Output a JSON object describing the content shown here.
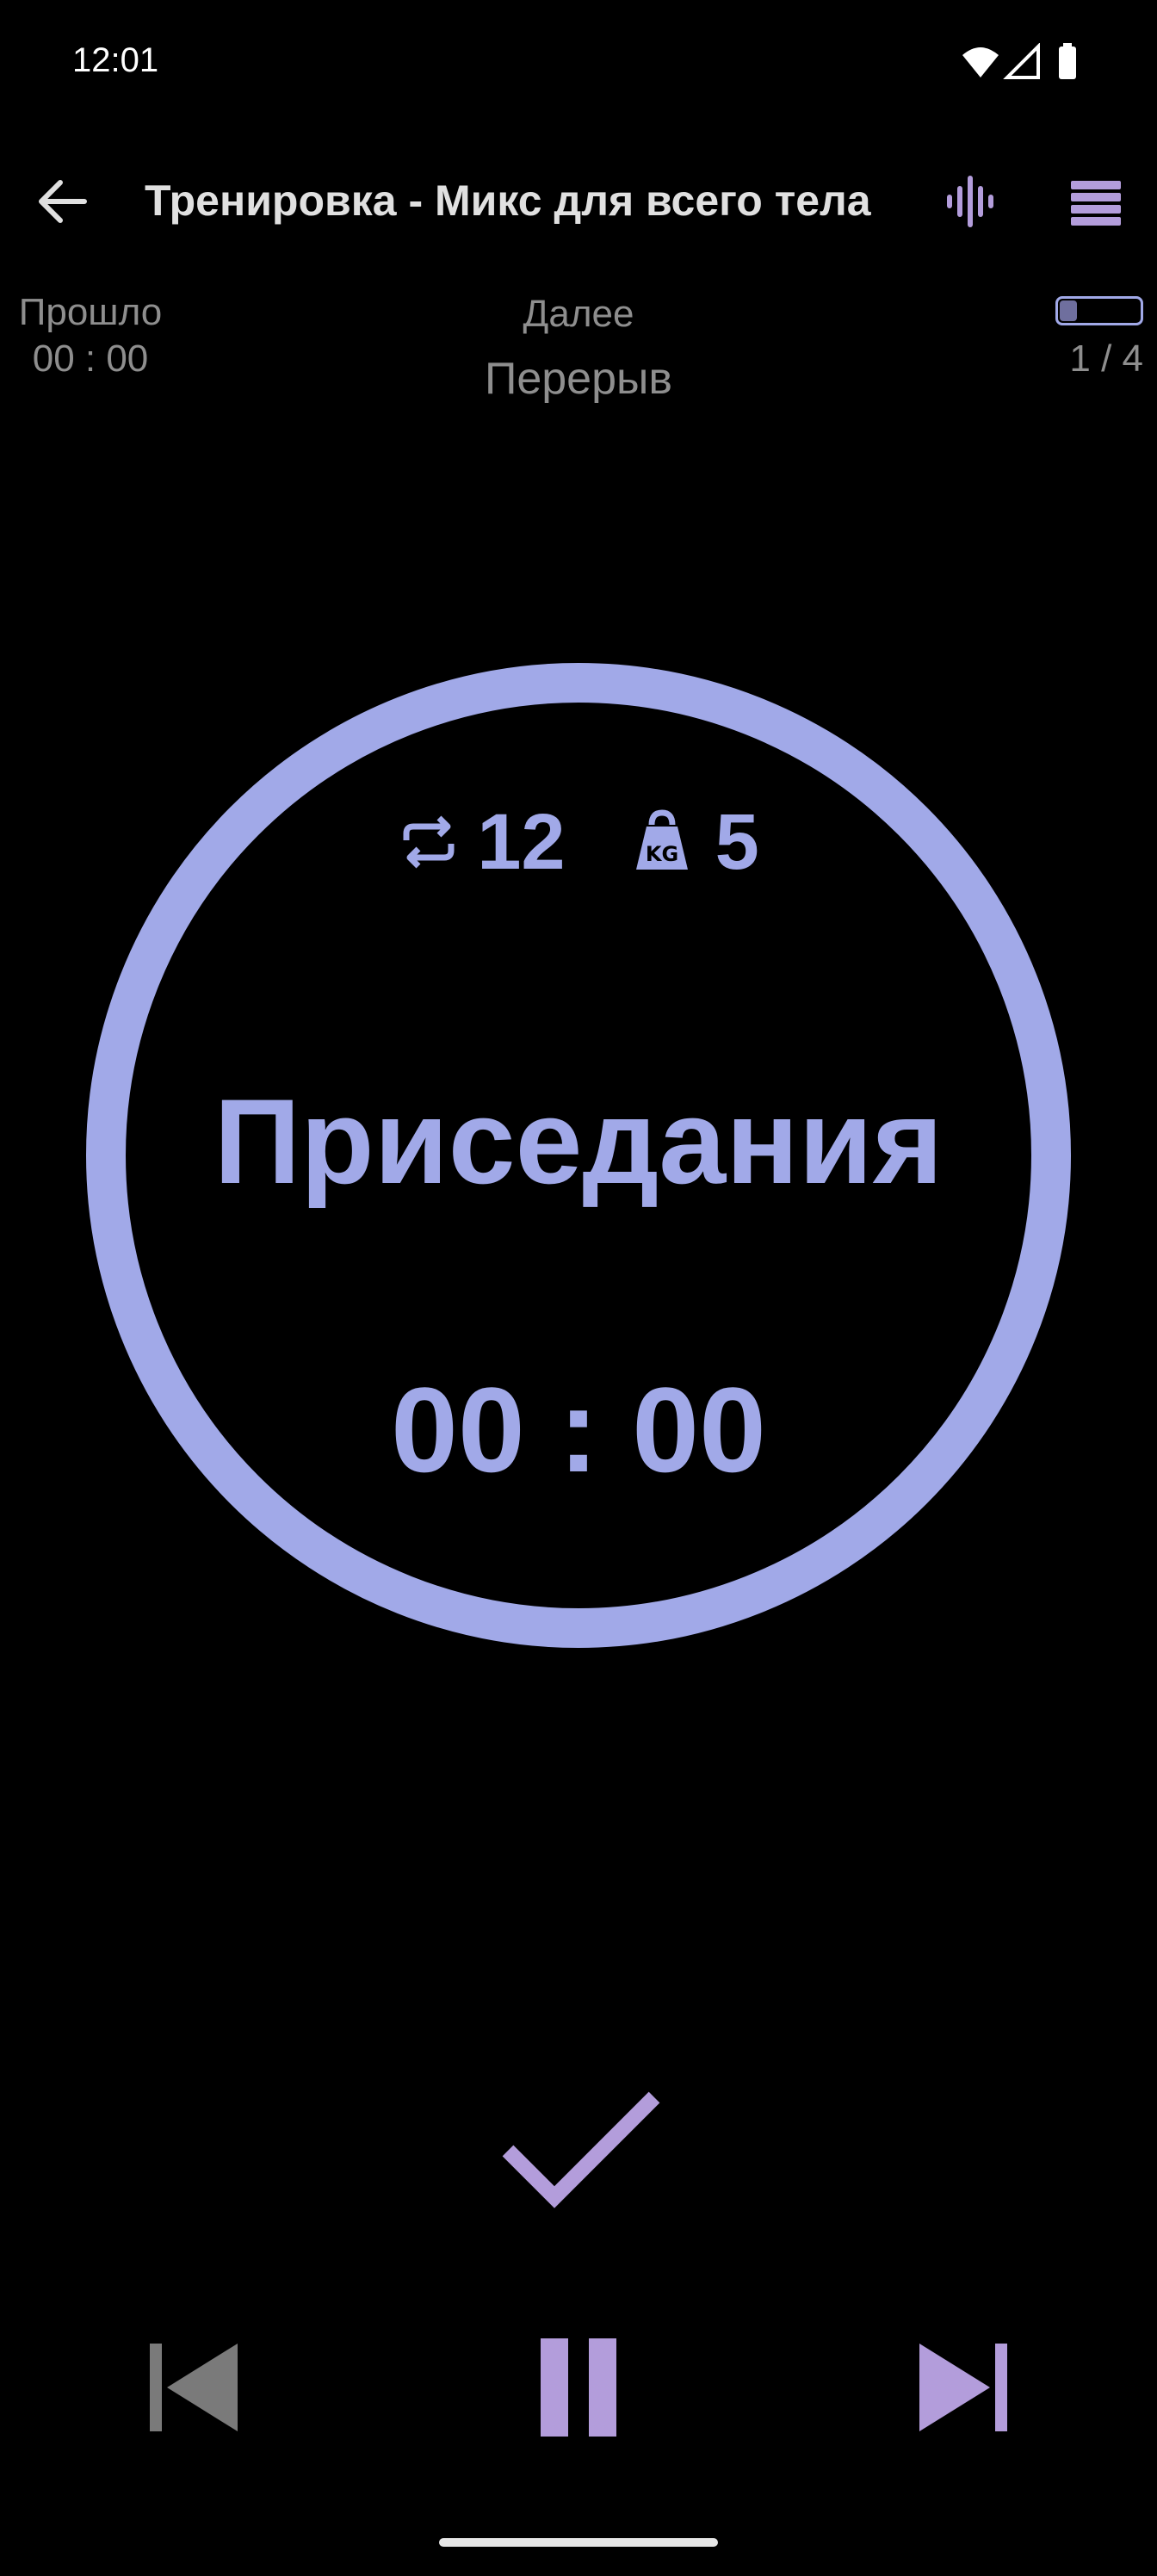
{
  "status_bar": {
    "time": "12:01"
  },
  "app_bar": {
    "title": "Тренировка - Микс для всего тела",
    "back_icon": "arrow-left-icon",
    "sound_icon": "sound-wave-icon",
    "menu_icon": "menu-icon"
  },
  "info": {
    "elapsed_label": "Прошло",
    "elapsed_value": "00 : 00",
    "next_label": "Далее",
    "next_value": "Перерыв",
    "progress_text": "1 / 4",
    "progress_fraction": 0.25
  },
  "exercise": {
    "reps_icon": "repeat-icon",
    "reps": "12",
    "weight_icon": "kettlebell-kg-icon",
    "weight": "5",
    "name": "Приседания",
    "timer": "00 : 00"
  },
  "controls": {
    "done_icon": "checkmark-icon",
    "prev_icon": "skip-previous-icon",
    "pause_icon": "pause-icon",
    "next_icon": "skip-next-icon"
  },
  "colors": {
    "background": "#000000",
    "accent": "#a1a9e8",
    "accent_purple": "#b39ddb",
    "disabled": "#7a7a7a",
    "text_secondary": "#8e8e8e"
  }
}
